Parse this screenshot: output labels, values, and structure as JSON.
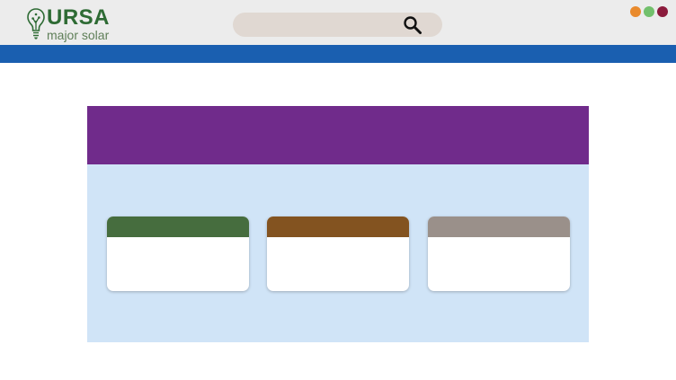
{
  "header": {
    "logo": {
      "wordmark": "URSA",
      "tagline": "major solar",
      "color": "#2e6b34"
    },
    "search": {
      "icon": "search-icon",
      "background": "#e0d8d2"
    },
    "window_controls": [
      {
        "name": "orange-dot",
        "color": "#e98a2c"
      },
      {
        "name": "green-dot",
        "color": "#72c06c"
      },
      {
        "name": "maroon-dot",
        "color": "#8b1b3c"
      }
    ]
  },
  "colors": {
    "topbar": "#ececec",
    "navbar": "#1a5fb0",
    "panel_header": "#702b8b",
    "panel_body": "#d0e4f7"
  },
  "cards": [
    {
      "accent": "#466d3e"
    },
    {
      "accent": "#835320"
    },
    {
      "accent": "#9a908a"
    }
  ]
}
